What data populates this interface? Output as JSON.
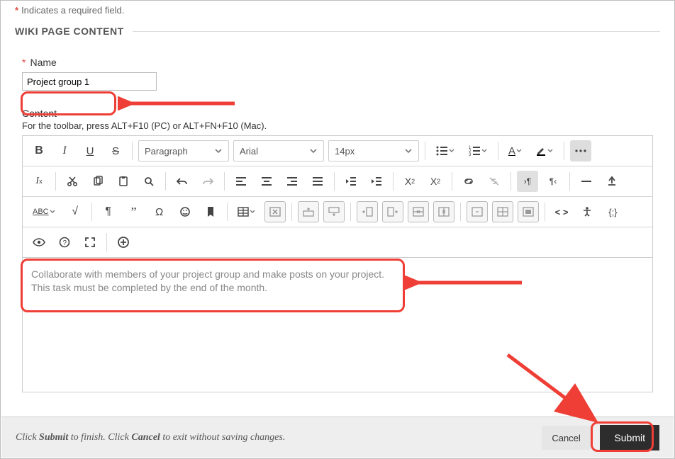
{
  "required_note": "Indicates a required field.",
  "section_title": "WIKI PAGE CONTENT",
  "name_label": "Name",
  "name_value": "Project group 1",
  "content_label": "Content",
  "toolbar_hint": "For the toolbar, press ALT+F10 (PC) or ALT+FN+F10 (Mac).",
  "format_selects": {
    "block": "Paragraph",
    "font": "Arial",
    "size": "14px"
  },
  "editor_line1": "Collaborate with members of your project group and make posts on your project.",
  "editor_line2": "This task must be completed by the end of the month.",
  "footer_pre": "Click ",
  "footer_submit": "Submit",
  "footer_mid": " to finish. Click ",
  "footer_cancel": "Cancel",
  "footer_post": " to exit without saving changes.",
  "cancel_btn": "Cancel",
  "submit_btn": "Submit"
}
